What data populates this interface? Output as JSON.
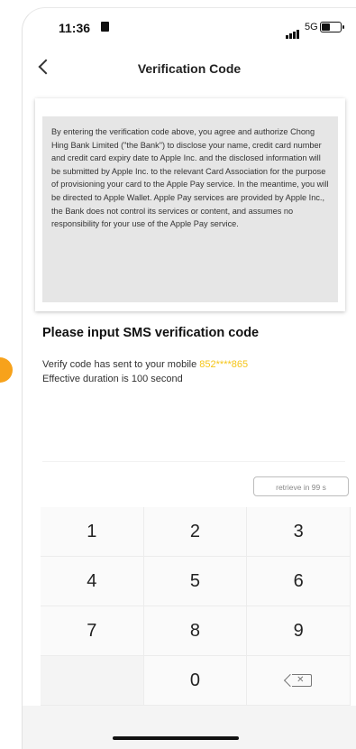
{
  "status_bar": {
    "time": "11:36",
    "network": "5G"
  },
  "nav": {
    "title": "Verification Code"
  },
  "disclaimer": {
    "text": "By entering the verification code above, you agree and authorize Chong Hing Bank Limited (\"the Bank\") to disclose your name, credit card number and credit card expiry date to Apple Inc. and the disclosed information will be submitted by Apple Inc. to the relevant Card Association for the purpose of provisioning your card to the Apple Pay service. In the meantime, you will be directed to Apple Wallet. Apple Pay services are provided by Apple Inc., the Bank does not control its services or content, and assumes no responsibility for your use of the Apple Pay service."
  },
  "sms": {
    "heading": "Please input SMS verification code",
    "sent_text": "Verify code has sent to your mobile",
    "masked_mobile": "852****865",
    "duration_text": "Effective duration is 100 second"
  },
  "retrieve_button": {
    "label": "retrieve in 99 s"
  },
  "keypad": {
    "keys": [
      "1",
      "2",
      "3",
      "4",
      "5",
      "6",
      "7",
      "8",
      "9",
      "",
      "0",
      "backspace"
    ]
  },
  "colors": {
    "accent": "#f7a21b",
    "masked_mobile": "#f5c518"
  }
}
